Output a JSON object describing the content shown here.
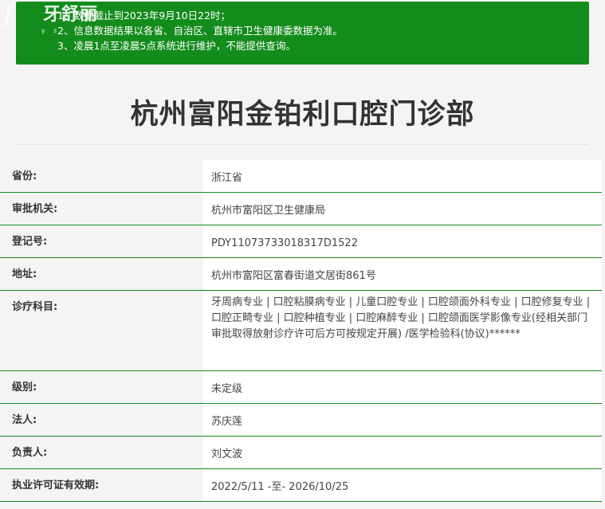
{
  "logo": {
    "text": "牙舒丽",
    "sub": "y s",
    "mark": "?"
  },
  "notice": {
    "lines": [
      "1、数据截止到2023年9月10日22时；",
      "2、信息数据结果以各省、自治区、直辖市卫生健康委数据为准。",
      "3、凌晨1点至凌晨5点系统进行维护，不能提供查询。"
    ]
  },
  "page_title": "杭州富阳金铂利口腔门诊部",
  "fields": [
    {
      "label": "省份:",
      "value": "浙江省"
    },
    {
      "label": "审批机关:",
      "value": "杭州市富阳区卫生健康局"
    },
    {
      "label": "登记号:",
      "value": "PDY11073733018317D1522"
    },
    {
      "label": "地址:",
      "value": "杭州市富阳区富春街道文居街861号"
    },
    {
      "label": "诊疗科目:",
      "value": "牙周病专业 | 口腔粘膜病专业 | 儿童口腔专业 | 口腔颌面外科专业 | 口腔修复专业 | 口腔正畸专业 | 口腔种植专业 | 口腔麻醉专业 | 口腔颌面医学影像专业(经相关部门审批取得放射诊疗许可后方可按规定开展) /医学检验科(协议)******"
    },
    {
      "label": "级别:",
      "value": "未定级"
    },
    {
      "label": "法人:",
      "value": "苏庆莲"
    },
    {
      "label": "负责人:",
      "value": "刘文波"
    },
    {
      "label": "执业许可证有效期:",
      "value": "2022/5/11 -至- 2026/10/25"
    }
  ],
  "colors": {
    "accent": "#148c1d",
    "background": "#f4f4f4",
    "value_background": "#ffffff"
  }
}
